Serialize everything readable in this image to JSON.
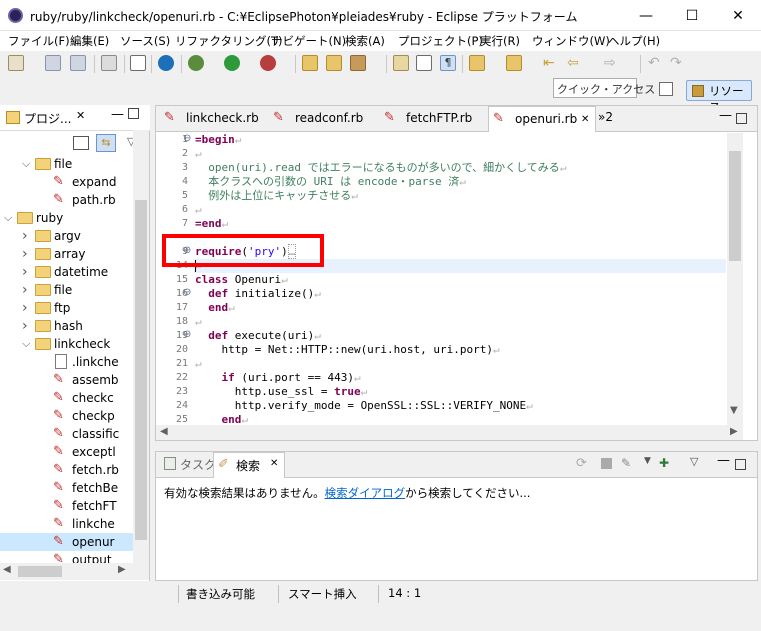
{
  "window": {
    "title": "ruby/ruby/linkcheck/openuri.rb - C:¥EclipsePhoton¥pleiades¥ruby - Eclipse プラットフォーム",
    "min": "—",
    "max": "☐",
    "close": "✕"
  },
  "menu": [
    "ファイル(F)",
    "編集(E)",
    "ソース(S)",
    "リファクタリング(T)",
    "ナビゲート(N)",
    "検索(A)",
    "プロジェクト(P)",
    "実行(R)",
    "ウィンドウ(W)",
    "ヘルプ(H)"
  ],
  "quick_access": "クイック・アクセス",
  "resource_button": "リソース",
  "left_pane": {
    "title": "プロジ...",
    "tree": [
      {
        "label": "file",
        "type": "folder",
        "expanded": true
      },
      {
        "label": "expand",
        "type": "rb"
      },
      {
        "label": "path.rb",
        "type": "rb"
      },
      {
        "label": "ruby",
        "type": "folder",
        "expanded": true
      },
      {
        "label": "argv",
        "type": "folder",
        "expanded": false
      },
      {
        "label": "array",
        "type": "folder",
        "expanded": false
      },
      {
        "label": "datetime",
        "type": "folder",
        "expanded": false
      },
      {
        "label": "file",
        "type": "folder",
        "expanded": false
      },
      {
        "label": "ftp",
        "type": "folder",
        "expanded": false
      },
      {
        "label": "hash",
        "type": "folder",
        "expanded": false
      },
      {
        "label": "linkcheck",
        "type": "folder",
        "expanded": true
      },
      {
        "label": ".linkche",
        "type": "txt"
      },
      {
        "label": "assemb",
        "type": "rb"
      },
      {
        "label": "checkc",
        "type": "rb"
      },
      {
        "label": "checkp",
        "type": "rb"
      },
      {
        "label": "classific",
        "type": "rb"
      },
      {
        "label": "exceptl",
        "type": "rb"
      },
      {
        "label": "fetch.rb",
        "type": "rb"
      },
      {
        "label": "fetchBe",
        "type": "rb"
      },
      {
        "label": "fetchFT",
        "type": "rb"
      },
      {
        "label": "linkche",
        "type": "rb"
      },
      {
        "label": "openur",
        "type": "rb",
        "selected": true
      },
      {
        "label": "output",
        "type": "rb"
      }
    ]
  },
  "editor": {
    "tabs": [
      "linkcheck.rb",
      "readconf.rb",
      "fetchFTP.rb",
      "openuri.rb"
    ],
    "overflow": "»2",
    "active_tab": 3,
    "lines": [
      {
        "n": "1",
        "t": "=begin",
        "cls": "kw",
        "fold": "⊖"
      },
      {
        "n": "2",
        "t": "",
        "cls": ""
      },
      {
        "n": "3",
        "t": "  open(uri).read ではエラーになるものが多いので、細かくしてみる",
        "cls": "cm"
      },
      {
        "n": "4",
        "t": "  本クラスへの引数の URI は encode・parse 済",
        "cls": "cm"
      },
      {
        "n": "5",
        "t": "  例外は上位にキャッチさせる",
        "cls": "cm"
      },
      {
        "n": "6",
        "t": "",
        "cls": ""
      },
      {
        "n": "7",
        "t": "=end",
        "cls": "kw"
      },
      {
        "n": "9",
        "t": "require('pry')",
        "cls": "req",
        "fold": "⊕"
      },
      {
        "n": "14",
        "t": "",
        "cls": ""
      },
      {
        "n": "15",
        "t": "class Openuri",
        "cls": "class"
      },
      {
        "n": "16",
        "t": "  def initialize()",
        "cls": "def",
        "fold": "⊖"
      },
      {
        "n": "17",
        "t": "  end",
        "cls": "end"
      },
      {
        "n": "18",
        "t": "",
        "cls": ""
      },
      {
        "n": "19",
        "t": "  def execute(uri)",
        "cls": "def",
        "fold": "⊖"
      },
      {
        "n": "20",
        "t": "    http = Net::HTTP::new(uri.host, uri.port)",
        "cls": ""
      },
      {
        "n": "21",
        "t": "",
        "cls": ""
      },
      {
        "n": "22",
        "t": "    if (uri.port == 443)",
        "cls": "if"
      },
      {
        "n": "23",
        "t": "      http.use_ssl = true",
        "cls": "true"
      },
      {
        "n": "24",
        "t": "      http.verify_mode = OpenSSL::SSL::VERIFY_NONE",
        "cls": ""
      },
      {
        "n": "25",
        "t": "    end",
        "cls": "end"
      }
    ]
  },
  "bottom": {
    "tabs": [
      "タスク",
      "検索"
    ],
    "message_before": "有効な検索結果はありません。",
    "link": "検索ダイアログ",
    "message_after": "から検索してください..."
  },
  "status": {
    "writable": "書き込み可能",
    "insert": "スマート挿入",
    "position": "14 : 1"
  },
  "colors": {
    "highlight_box": "#ff0000",
    "keyword": "#7f0055",
    "comment": "#3f7f5f",
    "string": "#2a00ff",
    "link": "#0066cc"
  }
}
